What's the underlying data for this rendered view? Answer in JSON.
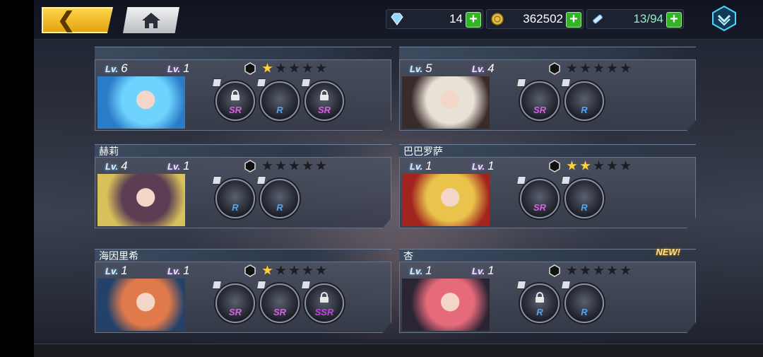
{
  "topbar": {
    "gem_count": "14",
    "gold_count": "362502",
    "stamina": "13/94",
    "accent": "#35b12a"
  },
  "cards": [
    {
      "name": "",
      "lv1": "6",
      "lv2": "1",
      "stars": 1,
      "is_new": false,
      "portrait_colors": [
        "#6fd3ff",
        "#2b7bc6"
      ],
      "equips": [
        {
          "rarity": "SR",
          "locked": true
        },
        {
          "rarity": "R",
          "locked": false
        },
        {
          "rarity": "SR",
          "locked": true
        }
      ]
    },
    {
      "name": "",
      "lv1": "5",
      "lv2": "4",
      "stars": 0,
      "is_new": false,
      "portrait_colors": [
        "#e8e2d6",
        "#3a2b2b"
      ],
      "equips": [
        {
          "rarity": "SR",
          "locked": false
        },
        {
          "rarity": "R",
          "locked": false
        }
      ]
    },
    {
      "name": "赫莉",
      "lv1": "4",
      "lv2": "1",
      "stars": 0,
      "is_new": false,
      "portrait_colors": [
        "#5b3d54",
        "#d8c05a"
      ],
      "equips": [
        {
          "rarity": "R",
          "locked": false
        },
        {
          "rarity": "R",
          "locked": false
        }
      ]
    },
    {
      "name": "巴巴罗萨",
      "lv1": "1",
      "lv2": "1",
      "stars": 2,
      "is_new": false,
      "portrait_colors": [
        "#e9c34b",
        "#a3241e"
      ],
      "equips": [
        {
          "rarity": "SR",
          "locked": false
        },
        {
          "rarity": "R",
          "locked": false
        }
      ]
    },
    {
      "name": "海因里希",
      "lv1": "1",
      "lv2": "1",
      "stars": 1,
      "is_new": false,
      "portrait_colors": [
        "#e07a4a",
        "#23416b"
      ],
      "equips": [
        {
          "rarity": "SR",
          "locked": false
        },
        {
          "rarity": "SR",
          "locked": false
        },
        {
          "rarity": "SSR",
          "locked": true
        }
      ]
    },
    {
      "name": "杏",
      "lv1": "1",
      "lv2": "1",
      "stars": 0,
      "is_new": true,
      "new_label": "NEW!",
      "portrait_colors": [
        "#e56a7a",
        "#2a2433"
      ],
      "equips": [
        {
          "rarity": "R",
          "locked": true
        },
        {
          "rarity": "R",
          "locked": false
        }
      ]
    }
  ],
  "labels": {
    "lv_tag": "Lv."
  }
}
